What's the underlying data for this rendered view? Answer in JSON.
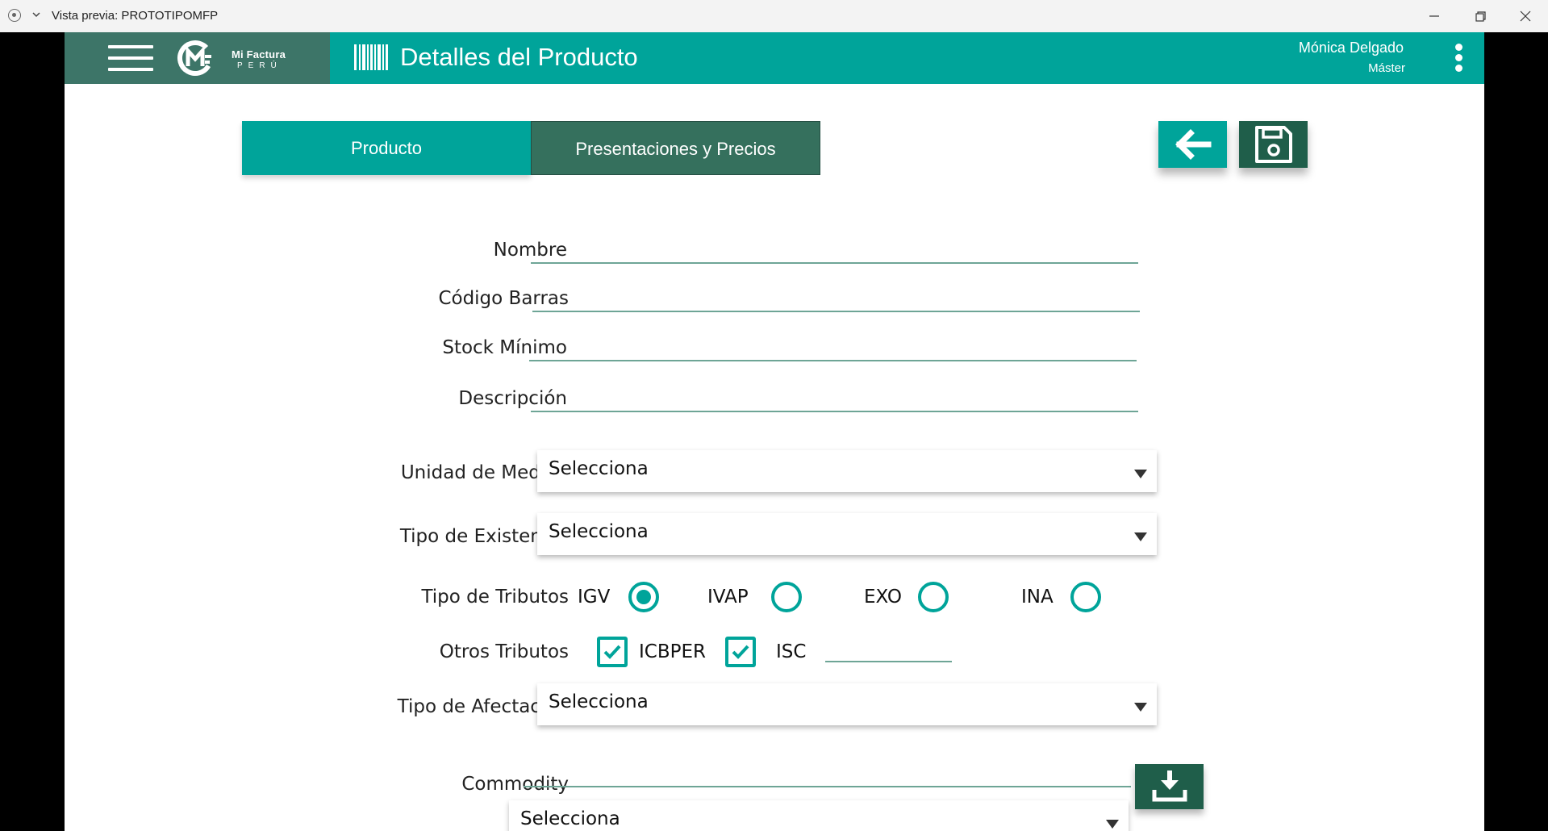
{
  "window": {
    "title": "Vista previa: PROTOTIPOMFP"
  },
  "header": {
    "logo_name": "Mi Factura",
    "logo_country": "PERÚ",
    "page_title": "Detalles del Producto",
    "user_name": "Mónica Delgado",
    "user_role": "Máster"
  },
  "tabs": [
    {
      "label": "Producto",
      "active": true
    },
    {
      "label": "Presentaciones y Precios",
      "active": false
    }
  ],
  "form": {
    "nombre": {
      "label": "Nombre",
      "value": ""
    },
    "codigo_barras": {
      "label": "Código Barras",
      "value": ""
    },
    "stock_minimo": {
      "label": "Stock Mínimo",
      "value": ""
    },
    "descripcion": {
      "label": "Descripción",
      "value": ""
    },
    "unidad_medida": {
      "label": "Unidad de Medida",
      "value": "Selecciona"
    },
    "tipo_existencia": {
      "label": "Tipo de Existencia",
      "value": "Selecciona"
    },
    "tipo_tributos": {
      "label": "Tipo de Tributos",
      "options": [
        {
          "label": "IGV",
          "selected": true
        },
        {
          "label": "IVAP",
          "selected": false
        },
        {
          "label": "EXO",
          "selected": false
        },
        {
          "label": "INA",
          "selected": false
        }
      ]
    },
    "otros_tributos": {
      "label": "Otros Tributos",
      "options": [
        {
          "label": "ICBPER",
          "checked": true
        },
        {
          "label": "ISC",
          "checked": true
        }
      ],
      "isc_value": ""
    },
    "tipo_afectacion": {
      "label": "Tipo de Afectación",
      "value": "Selecciona"
    },
    "commodity": {
      "label": "Commodity",
      "value": "",
      "select_value": "Selecciona"
    }
  },
  "colors": {
    "primary": "#00a49a",
    "dark_green": "#35705d",
    "header_brand": "#3d7568",
    "underline": "#6ea596"
  }
}
